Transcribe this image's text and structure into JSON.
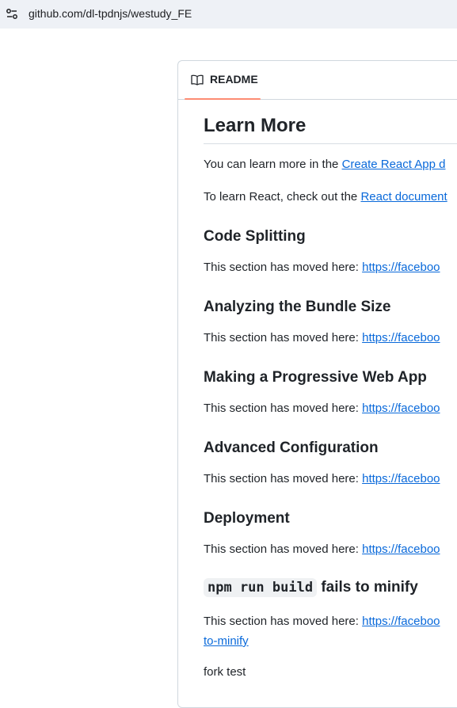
{
  "browser": {
    "url": "github.com/dl-tpdnjs/westudy_FE"
  },
  "readme": {
    "tab_label": "README",
    "title": "Learn More",
    "intro1_text": "You can learn more in the ",
    "intro1_link": "Create React App d",
    "intro2_text": "To learn React, check out the ",
    "intro2_link": "React document",
    "sections": [
      {
        "heading": "Code Splitting",
        "text": "This section has moved here: ",
        "link": "https://faceboo"
      },
      {
        "heading": "Analyzing the Bundle Size",
        "text": "This section has moved here: ",
        "link": "https://faceboo"
      },
      {
        "heading": "Making a Progressive Web App",
        "text": "This section has moved here: ",
        "link": "https://faceboo"
      },
      {
        "heading": "Advanced Configuration",
        "text": "This section has moved here: ",
        "link": "https://faceboo"
      },
      {
        "heading": "Deployment",
        "text": "This section has moved here: ",
        "link": "https://faceboo"
      }
    ],
    "last_section": {
      "code": "npm run build",
      "heading_rest": " fails to minify",
      "text": "This section has moved here: ",
      "link": "https://faceboo",
      "link_cont": "to-minify"
    },
    "footer_text": "fork test"
  }
}
